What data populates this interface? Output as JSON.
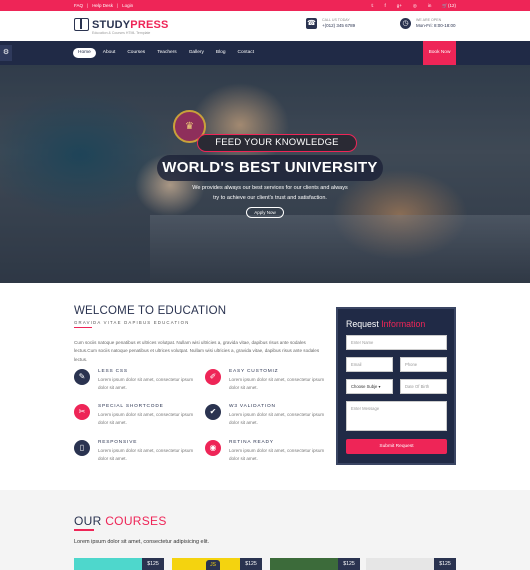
{
  "topbar": {
    "links": [
      "FAQ",
      "Help Desk",
      "Login"
    ],
    "social_icons": [
      "twitter-icon",
      "facebook-icon",
      "google-plus-icon",
      "dribbble-icon",
      "linkedin-icon"
    ],
    "cart": "(12)"
  },
  "header": {
    "logo_study": "STUDY",
    "logo_press": "PRESS",
    "tagline": "Education & Courses HTML Template",
    "call_label": "CALL US TODAY",
    "call_value": "+(012) 345 6789",
    "open_label": "WE ARE OPEN",
    "open_value": "Mon-Fri: 8:00-18:00"
  },
  "nav": {
    "items": [
      "Home",
      "About",
      "Courses",
      "Teachers",
      "Gallery",
      "Blog",
      "Contact"
    ],
    "book_now": "Book Now"
  },
  "hero": {
    "kicker": "FEED YOUR KNOWLEDGE",
    "title": "WORLD'S BEST UNIVERSITY",
    "text_line1": "We provides always our best services for our clients and always",
    "text_line2": "try to achieve our client's trust and satisfaction.",
    "cta": "Apply Now"
  },
  "welcome": {
    "title": "WELCOME TO EDUCATION",
    "subtitle": "GRAVIDA VITAE DAPIBUS EDUCATION",
    "paragraph": "Cum sociis natoque penatibus et ultrices volutpat. Nullam wisi ultricies a, gravida vitae, dapibus risus ante sodales lectus.Cum sociis natoque penatibus et ultrices volutpat. Nullam wisi ultricies a, gravida vitae, dapibus risus ante sodales lectus.",
    "features": [
      {
        "title": "LESS CSS",
        "desc": "Lorem ipsum dolor sit amet, consectetur ipsum dolor sit amet."
      },
      {
        "title": "EASY CUSTOMIZ",
        "desc": "Lorem ipsum dolor sit amet, consectetur ipsum dolor sit amet."
      },
      {
        "title": "SPECIAL SHORTCODE",
        "desc": "Lorem ipsum dolor sit amet, consectetur ipsum dolor sit amet."
      },
      {
        "title": "W3 VALIDATION",
        "desc": "Lorem ipsum dolor sit amet, consectetur ipsum dolor sit amet."
      },
      {
        "title": "RESPONSIVE",
        "desc": "Lorem ipsum dolor sit amet, consectetur ipsum dolor sit amet."
      },
      {
        "title": "RETINA READY",
        "desc": "Lorem ipsum dolor sit amet, consectetur ipsum dolor sit amet."
      }
    ]
  },
  "request": {
    "title_a": "Request",
    "title_b": "Information",
    "name_ph": "Enter Name",
    "email_ph": "Email",
    "phone_ph": "Phone",
    "subject_value": "Choose Subje",
    "dob_ph": "Date Of Birth",
    "message_ph": "Enter Message",
    "submit": "Submit Request"
  },
  "courses": {
    "title_a": "OUR",
    "title_b": "COURSES",
    "intro": "Lorem ipsum dolor sit amet, consectetur adipisicing elit.",
    "prices": [
      "$125",
      "$125",
      "$125",
      "$125"
    ]
  }
}
